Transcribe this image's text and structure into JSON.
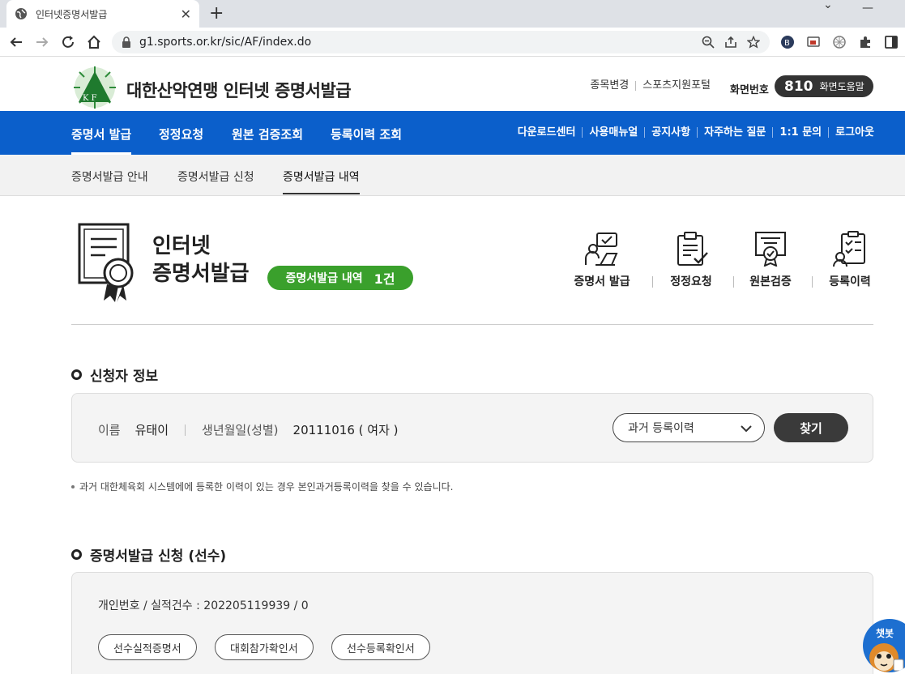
{
  "browser": {
    "tab_title": "인터넷증명서발급",
    "url": "g1.sports.or.kr/sic/AF/index.do"
  },
  "header": {
    "site_title": "대한산악연맹 인터넷 증명서발급",
    "logo_letters": "K F",
    "util_links": [
      "종목변경",
      "스포츠지원포털"
    ],
    "phone_label": "화면번호",
    "phone_number": "810",
    "phone_help": "화면도움말"
  },
  "main_nav": {
    "items": [
      "증명서 발급",
      "정정요청",
      "원본 검증조회",
      "등록이력 조회"
    ],
    "right_links": [
      "다운로드센터",
      "사용매뉴얼",
      "공지사항",
      "자주하는 질문",
      "1:1 문의",
      "로그아웃"
    ]
  },
  "sub_nav": {
    "items": [
      "증명서발급 안내",
      "증명서발급 신청",
      "증명서발급 내역"
    ]
  },
  "page": {
    "title_line1": "인터넷",
    "title_line2": "증명서발급",
    "badge_label": "증명서발급 내역",
    "badge_count": "1건"
  },
  "quick_links": [
    "증명서 발급",
    "정정요청",
    "원본검증",
    "등록이력"
  ],
  "applicant": {
    "section_title": "신청자 정보",
    "name_label": "이름",
    "name_value": "유태이",
    "birth_label": "생년월일(성별)",
    "birth_value": "20111016 ( 여자 )",
    "select_value": "과거 등록이력",
    "find_button": "찾기",
    "note": "과거 대한체육회 시스템에에 등록한 이력이 있는 경우 본인과거등록이력을 찾을 수 있습니다."
  },
  "apply": {
    "section_title": "증명서발급 신청 (선수)",
    "info_label": "개인번호 / 실적건수 :",
    "info_value": "202205119939 / 0",
    "buttons": [
      "선수실적증명서",
      "대회참가확인서",
      "선수등록확인서"
    ]
  },
  "chatbot": {
    "label": "챗봇"
  },
  "colors": {
    "nav_blue": "#0b5fcb",
    "badge_green": "#3aa02c",
    "dark_button": "#3a3a3a"
  }
}
